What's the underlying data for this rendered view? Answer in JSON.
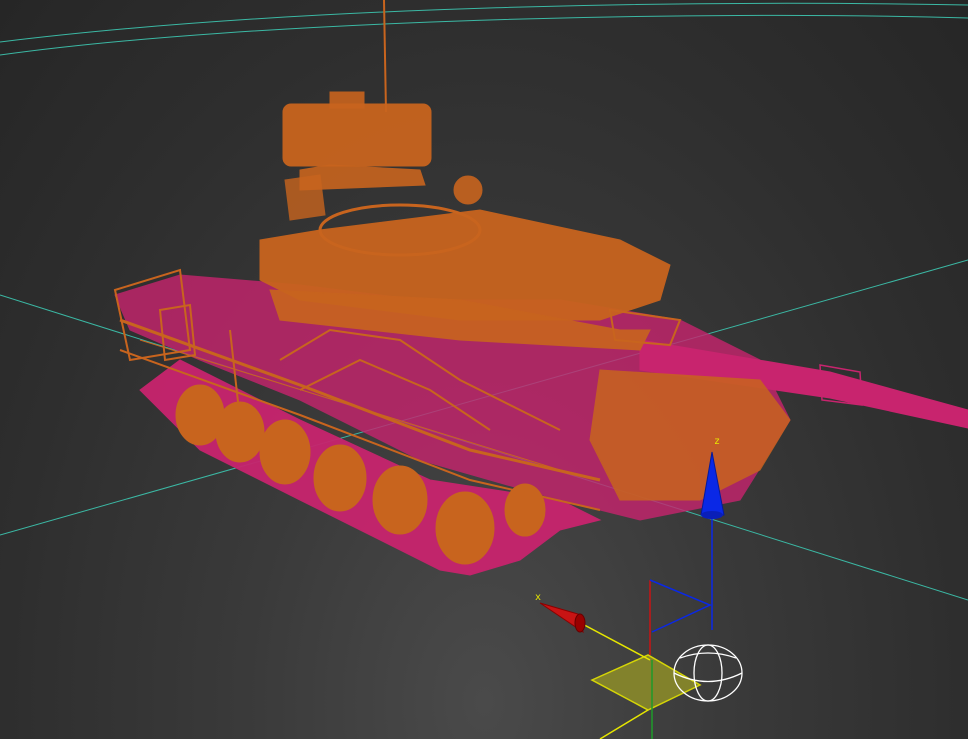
{
  "viewport": {
    "background": "#2e2e2e",
    "grid_color": "#3bb8a4"
  },
  "scene": {
    "object": "tank-wireframe",
    "colors": {
      "orange": "#c8641e",
      "magenta": "#c8246e"
    }
  },
  "gizmo": {
    "x_label": "x",
    "z_label": "z",
    "x_color": "#c81414",
    "y_color": "#e6e600",
    "z_color": "#0a28e6",
    "plane_color": "#8a8a2a"
  }
}
